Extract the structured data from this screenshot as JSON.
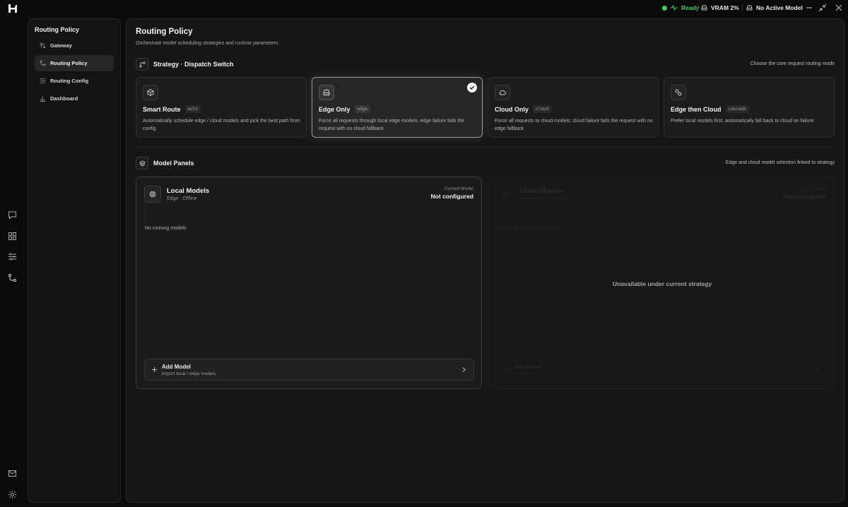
{
  "topbar": {
    "status_ready": "Ready",
    "vram": "VRAM 2%",
    "active_model": "No Active Model",
    "colors": {
      "ready": "#3fcf6e"
    }
  },
  "sidebar": {
    "title": "Routing Policy",
    "items": [
      {
        "label": "Gateway",
        "icon": "gateway-icon",
        "active": false
      },
      {
        "label": "Routing Policy",
        "icon": "routing-icon",
        "active": true
      },
      {
        "label": "Routing Config",
        "icon": "sliders-icon",
        "active": false
      },
      {
        "label": "Dashboard",
        "icon": "bar-chart-icon",
        "active": false
      }
    ]
  },
  "page": {
    "title": "Routing Policy",
    "subtitle": "Orchestrate model scheduling strategies and runtime parameters"
  },
  "strategy": {
    "title": "Strategy · Dispatch Switch",
    "note": "Choose the core request routing mode",
    "selected": "edge",
    "cards": [
      {
        "title": "Smart Route",
        "tag": "auto",
        "icon": "cube-icon",
        "desc": "Automatically schedule edge / cloud models and pick the best path from config"
      },
      {
        "title": "Edge Only",
        "tag": "edge",
        "icon": "hard-drive-icon",
        "desc": "Force all requests through local edge models; edge failure fails the request with no cloud fallback"
      },
      {
        "title": "Cloud Only",
        "tag": "cloud",
        "icon": "cloud-icon",
        "desc": "Force all requests to cloud models; cloud failure fails the request with no edge fallback"
      },
      {
        "title": "Edge then Cloud",
        "tag": "cascade",
        "icon": "link-icon",
        "desc": "Prefer local models first, automatically fall back to cloud on failure"
      }
    ]
  },
  "models": {
    "title": "Model Panels",
    "note": "Edge and cloud model selection linked to strategy",
    "local": {
      "title": "Local Models",
      "subtitle": "Edge · Offline",
      "current_label": "Current Model",
      "current_value": "Not configured",
      "empty": "No running models",
      "add_title": "Add Model",
      "add_sub": "Import local / edge models"
    },
    "cloud": {
      "title": "Cloud Models",
      "subtitle": "Multi-vendor · Online API",
      "current_label": "Current Model",
      "current_value": "Not configured",
      "empty": "Sign in to see cloud models",
      "overlay": "Unavailable under current strategy",
      "adv_title": "Advanced",
      "adv_sub": "Credentials"
    }
  }
}
